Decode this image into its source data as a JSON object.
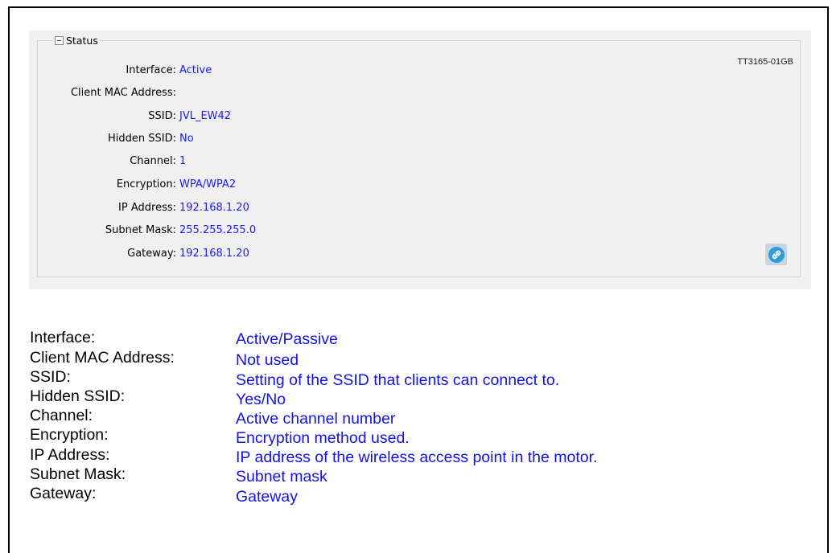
{
  "status_group": {
    "title": "Status",
    "doc_id": "TT3165-01GB",
    "fields": [
      {
        "label": "Interface:",
        "value": "Active"
      },
      {
        "label": "Client MAC Address:",
        "value": ""
      },
      {
        "label": "SSID:",
        "value": "JVL_EW42"
      },
      {
        "label": "Hidden SSID:",
        "value": "No"
      },
      {
        "label": "Channel:",
        "value": "1"
      },
      {
        "label": "Encryption:",
        "value": "WPA/WPA2"
      },
      {
        "label": "IP Address:",
        "value": "192.168.1.20"
      },
      {
        "label": "Subnet Mask:",
        "value": "255.255.255.0"
      },
      {
        "label": "Gateway:",
        "value": "192.168.1.20"
      }
    ],
    "link_button_icon": "link-icon"
  },
  "descriptions": [
    {
      "label": "Interface:",
      "text": "Active/Passive"
    },
    {
      "label": "Client MAC Address:",
      "text": "Not used"
    },
    {
      "label": "SSID:",
      "text": "Setting of the SSID that clients can connect to."
    },
    {
      "label": "Hidden SSID:",
      "text": "Yes/No"
    },
    {
      "label": "Channel:",
      "text": "Active channel number"
    },
    {
      "label": "Encryption:",
      "text": "Encryption method used."
    },
    {
      "label": "IP Address:",
      "text": "IP address of the wireless access point in the motor."
    },
    {
      "label": "Subnet Mask:",
      "text": "Subnet mask"
    },
    {
      "label": "Gateway:",
      "text": "Gateway"
    }
  ],
  "colors": {
    "value_blue": "#1a1aff",
    "panel_bg": "#f0f0f0",
    "button_bg": "#c8d4e0"
  }
}
